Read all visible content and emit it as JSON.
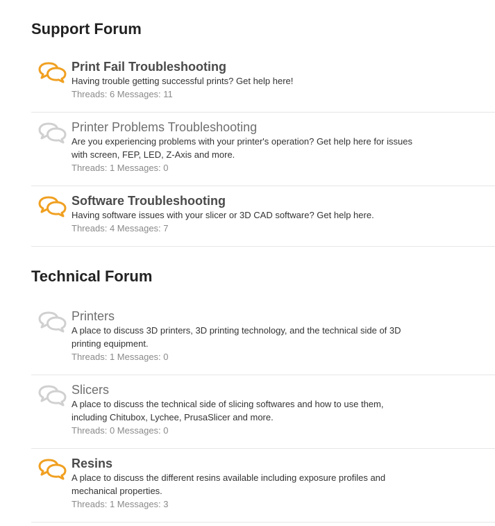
{
  "categories": [
    {
      "title": "Support Forum",
      "forums": [
        {
          "title": "Print Fail Troubleshooting",
          "unread": true,
          "description": "Having trouble getting successful prints? Get help here!",
          "threads_label": "Threads:",
          "threads": "6",
          "messages_label": "Messages:",
          "messages": "11"
        },
        {
          "title": "Printer Problems Troubleshooting",
          "unread": false,
          "description": "Are you experiencing problems with your printer's operation? Get help here for issues with screen, FEP, LED, Z-Axis and more.",
          "threads_label": "Threads:",
          "threads": "1",
          "messages_label": "Messages:",
          "messages": "0"
        },
        {
          "title": "Software Troubleshooting",
          "unread": true,
          "description": "Having software issues with your slicer or 3D CAD software? Get help here.",
          "threads_label": "Threads:",
          "threads": "4",
          "messages_label": "Messages:",
          "messages": "7"
        }
      ]
    },
    {
      "title": "Technical Forum",
      "forums": [
        {
          "title": "Printers",
          "unread": false,
          "description": "A place to discuss 3D printers, 3D printing technology, and the technical side of 3D printing equipment.",
          "threads_label": "Threads:",
          "threads": "1",
          "messages_label": "Messages:",
          "messages": "0"
        },
        {
          "title": "Slicers",
          "unread": false,
          "description": "A place to discuss the technical side of slicing softwares and how to use them, including Chitubox, Lychee, PrusaSlicer and more.",
          "threads_label": "Threads:",
          "threads": "0",
          "messages_label": "Messages:",
          "messages": "0"
        },
        {
          "title": "Resins",
          "unread": true,
          "description": "A place to discuss the different resins available including exposure profiles and mechanical properties.",
          "threads_label": "Threads:",
          "threads": "1",
          "messages_label": "Messages:",
          "messages": "3"
        }
      ]
    }
  ],
  "icons": {
    "unread": "chat-bubbles-icon",
    "read": "chat-bubbles-icon"
  },
  "colors": {
    "unread_icon": "#f0a021",
    "read_icon": "#d0d0d0"
  }
}
